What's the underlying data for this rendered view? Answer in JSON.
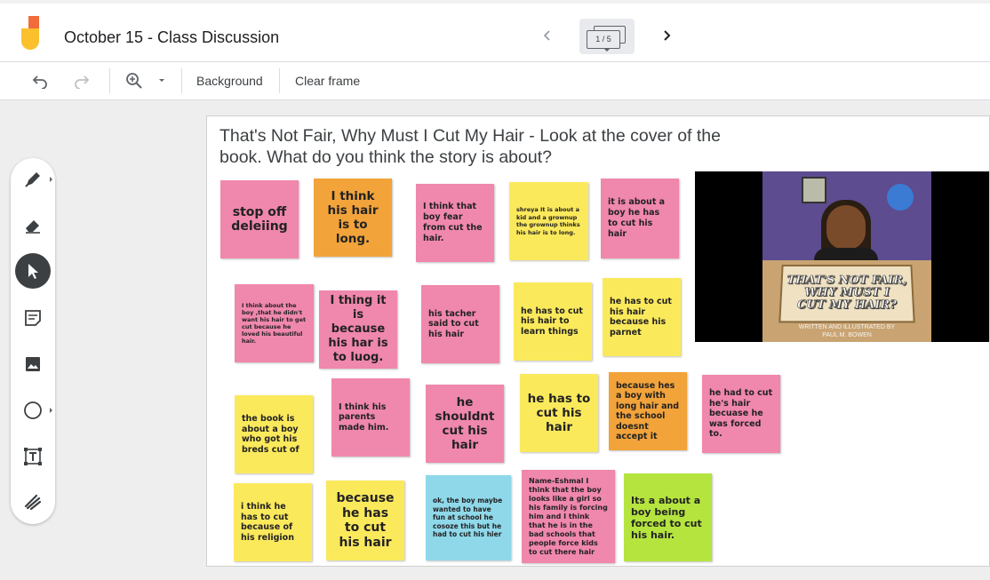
{
  "header": {
    "title": "October 15 - Class Discussion",
    "frame_indicator": "1 / 5"
  },
  "toolbar": {
    "background_label": "Background",
    "clear_frame_label": "Clear frame"
  },
  "tools": [
    "pen-icon",
    "eraser-icon",
    "select-icon",
    "sticky-note-icon",
    "image-icon",
    "circle-icon",
    "text-box-icon",
    "laser-icon"
  ],
  "canvas": {
    "prompt": "That's Not Fair, Why Must I Cut My Hair - Look at the cover of the book.  What do you think the story is about?",
    "cover": {
      "title_line1": "THAT'S NOT FAIR,",
      "title_line2": "WHY MUST I",
      "title_line3": "CUT MY HAIR?",
      "credit_line1": "WRITTEN AND ILLUSTRATED BY",
      "credit_line2": "PAUL M. BOWEN"
    },
    "notes": [
      {
        "text": "stop off deleiing",
        "color": "pink"
      },
      {
        "text": "I  think  his hair  is  to long.",
        "color": "orange"
      },
      {
        "text": "I think that boy fear from cut the hair.",
        "color": "pink"
      },
      {
        "text": "shreya    It is about a kid and a grownup the grownup thinks his hair is to long.",
        "color": "yellow"
      },
      {
        "text": "it is about a boy he has to cut his hair",
        "color": "pink"
      },
      {
        "text": "I think about the boy ,that he didn't want his hair to get cut because he loved his beautiful hair.",
        "color": "pink"
      },
      {
        "text": "I thing it is because his har is to luog.",
        "color": "pink"
      },
      {
        "text": "his  tacher said    to cut his  hair",
        "color": "pink"
      },
      {
        "text": "he  has  to  cut his  hair  to learn  things",
        "color": "yellow"
      },
      {
        "text": "he   has to cut his hair because his parnet",
        "color": "yellow"
      },
      {
        "text": "the book is about a boy who got his breds cut of",
        "color": "yellow"
      },
      {
        "text": "I  think  his parents  made him.",
        "color": "pink"
      },
      {
        "text": "he shouldnt cut his hair",
        "color": "pink"
      },
      {
        "text": "he  has  to cut  his hair",
        "color": "yellow"
      },
      {
        "text": "because  hes a boy with long hair and the school doesnt accept it",
        "color": "orange"
      },
      {
        "text": "he had to cut he's hair becuase he was forced to.",
        "color": "pink"
      },
      {
        "text": "i think he has to cut because of his religion",
        "color": "yellow"
      },
      {
        "text": "because he  has  to cut  his hair",
        "color": "yellow"
      },
      {
        "text": "ok, the boy maybe wanted to have fun at school he cosoze this but he had to cut his hier",
        "color": "blue"
      },
      {
        "text": "Name-Eshmal I think that the boy looks like a girl so his family is forcing him and I think that he is in the bad schools that people force kids to cut there hair",
        "color": "pink"
      },
      {
        "text": "Its a about a boy being forced to cut his hair.",
        "color": "green"
      }
    ]
  },
  "colors": {
    "pink": "#f087ac",
    "orange": "#f2a33a",
    "yellow": "#fbe95c",
    "blue": "#8fd8ea",
    "green": "#b5e43e"
  }
}
